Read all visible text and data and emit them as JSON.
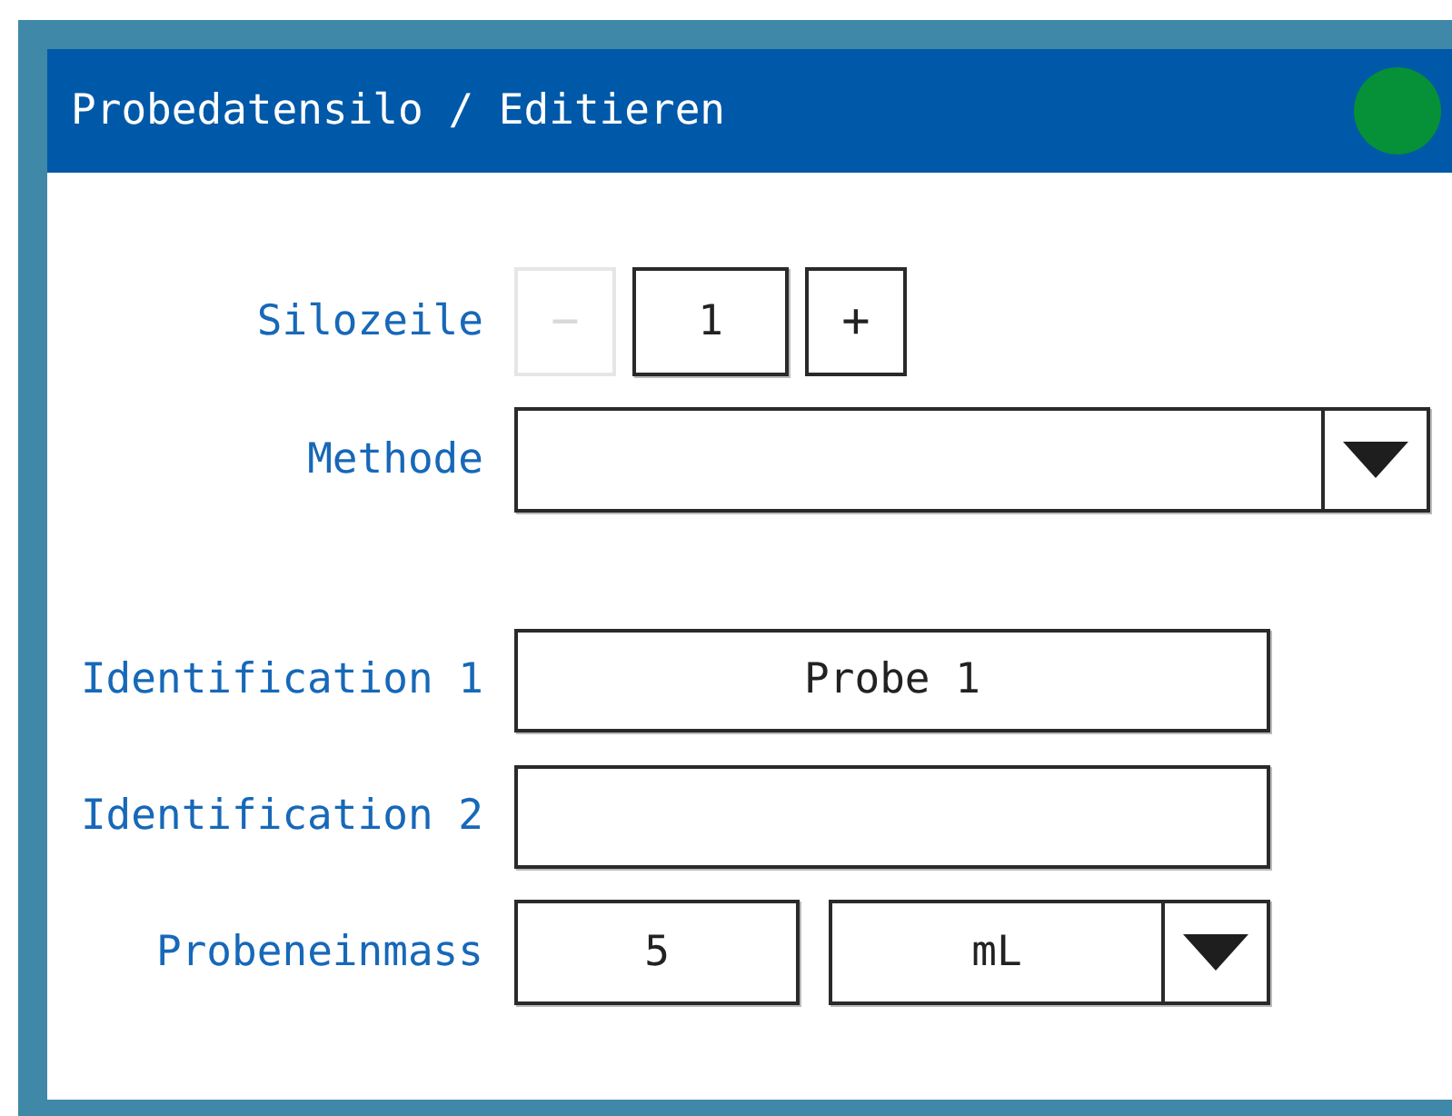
{
  "window": {
    "title": "Probedatensilo / Editieren",
    "connected": true
  },
  "silozeile": {
    "label": "Silozeile",
    "decrement": {
      "label": "−",
      "disabled": true
    },
    "value": "1",
    "increment": {
      "label": "+",
      "disabled": false
    }
  },
  "methode": {
    "label": "Methode"
  },
  "identification_1": {
    "label": "Identification 1",
    "value": "Probe 1"
  },
  "identification_2": {
    "label": "Identification 2"
  },
  "probeneinmass": {
    "label": "Probeneinmass",
    "value": "5",
    "unit": "mL"
  }
}
